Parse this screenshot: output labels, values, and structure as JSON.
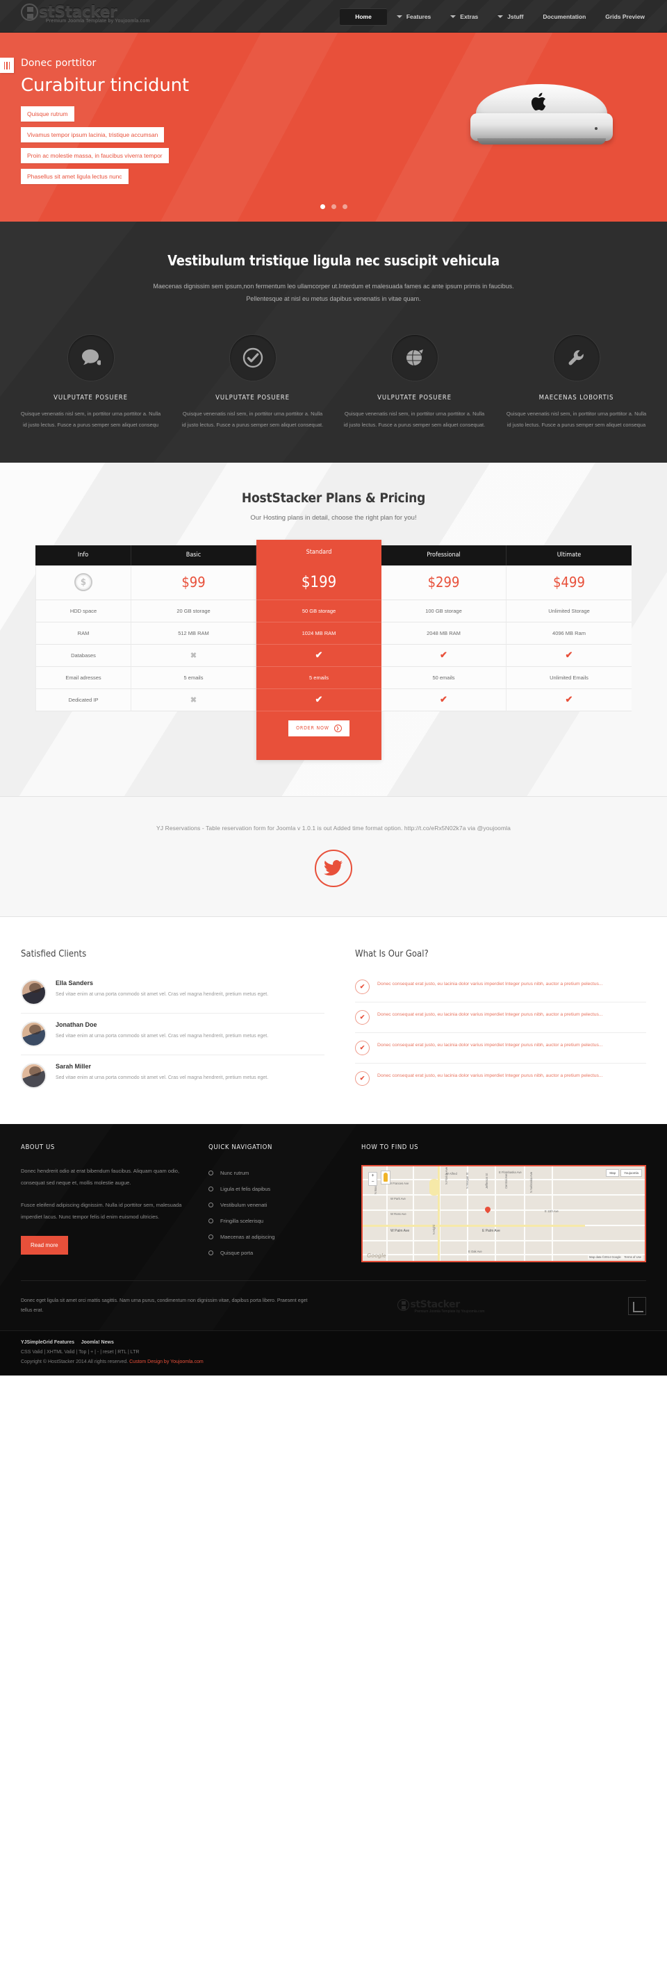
{
  "header": {
    "logo_text": "stStacker",
    "logo_tagline": "Premium Joomla Template by Youjoomla.com",
    "nav": [
      {
        "label": "Home",
        "active": true,
        "caret": false
      },
      {
        "label": "Features",
        "active": false,
        "caret": true
      },
      {
        "label": "Extras",
        "active": false,
        "caret": true
      },
      {
        "label": "Jstuff",
        "active": false,
        "caret": true
      },
      {
        "label": "Documentation",
        "active": false,
        "caret": false
      },
      {
        "label": "Grids Preview",
        "active": false,
        "caret": false
      }
    ]
  },
  "hero": {
    "kicker": "Donec porttitor",
    "title": "Curabitur tincidunt",
    "items": [
      "Quisque rutrum",
      "Vivamus tempor ipsum lacinia, tristique accumsan",
      "Proin ac molestie massa, in faucibus viverra tempor",
      "Phasellus sit amet ligula lectus nunc"
    ],
    "dots": [
      true,
      false,
      false
    ]
  },
  "features": {
    "title": "Vestibulum tristique ligula nec suscipit vehicula",
    "subtitle_line1": "Maecenas dignissim sem ipsum,non fermentum leo ullamcorper ut.Interdum et malesuada fames ac ante ipsum primis in faucibus.",
    "subtitle_line2": "Pellentesque at nisl eu metus dapibus venenatis in vitae quam.",
    "items": [
      {
        "icon": "speech-bubble-icon",
        "title": "VULPUTATE POSUERE",
        "text": "Quisque venenatis nisl sem, in porttitor urna porttitor a. Nulla id justo lectus. Fusce a purus semper sem aliquet consequ"
      },
      {
        "icon": "check-circle-icon",
        "title": "VULPUTATE POSUERE",
        "text": "Quisque venenatis nisl sem, in porttitor urna porttitor a. Nulla id justo lectus. Fusce a purus semper sem aliquet consequat."
      },
      {
        "icon": "globe-icon",
        "title": "VULPUTATE POSUERE",
        "text": "Quisque venenatis nisl sem, in porttitor urna porttitor a. Nulla id justo lectus. Fusce a purus semper sem aliquet consequat."
      },
      {
        "icon": "wrench-icon",
        "title": "MAECENAS LOBORTIS",
        "text": "Quisque venenatis nisl sem, in porttitor urna porttitor a. Nulla id justo lectus. Fusce a purus semper sem aliquet consequa"
      }
    ]
  },
  "pricing": {
    "title": "HostStacker Plans & Pricing",
    "subtitle": "Our Hosting plans in detail, choose the right plan for you!",
    "order_label": "ORDER NOW",
    "row_labels": [
      "HDD space",
      "RAM",
      "Databases",
      "Email adresses",
      "Dedicated IP"
    ],
    "info_header": "Info",
    "columns": [
      {
        "name": "Basic",
        "price": "$99",
        "highlight": false,
        "cells": [
          "20 GB storage",
          "512 MB RAM",
          "cross",
          "5 emails",
          "cross"
        ]
      },
      {
        "name": "Standard",
        "price": "$199",
        "highlight": true,
        "cells": [
          "50 GB storage",
          "1024 MB RAM",
          "tick",
          "5 emails",
          "tick"
        ]
      },
      {
        "name": "Professional",
        "price": "$299",
        "highlight": false,
        "cells": [
          "100 GB storage",
          "2048 MB RAM",
          "tick",
          "50 emails",
          "tick"
        ]
      },
      {
        "name": "Ultimate",
        "price": "$499",
        "highlight": false,
        "cells": [
          "Unlimited Storage",
          "4096 MB Ram",
          "tick",
          "Unlimited Emails",
          "tick"
        ]
      }
    ]
  },
  "twitter": {
    "tweet": "YJ Reservations - Table reservation form for Joomla v 1.0.1 is out Added time format option. http://t.co/eRx5N02k7a via @youjoomla",
    "icon": "twitter-bird-icon"
  },
  "clients": {
    "heading": "Satisfied Clients",
    "items": [
      {
        "name": "Ella Sanders",
        "text": "Sed vitae enim at urna porta commodo sit amet vel. Cras vel magna hendrerit, pretium metus eget."
      },
      {
        "name": "Jonathan Doe",
        "text": "Sed vitae enim at urna porta commodo sit amet vel. Cras vel magna hendrerit, pretium metus eget."
      },
      {
        "name": "Sarah Miller",
        "text": "Sed vitae enim at urna porta commodo sit amet vel. Cras vel magna hendrerit, pretium metus eget."
      }
    ]
  },
  "goals": {
    "heading": "What Is Our Goal?",
    "items": [
      "Donec consequat erat justo, eu lacinia dolor varius imperdiet Integer purus nibh, auctor a pretium pelectus...",
      "Donec consequat erat justo, eu lacinia dolor varius imperdiet Integer purus nibh, auctor a pretium pelectus...",
      "Donec consequat erat justo, eu lacinia dolor varius imperdiet Integer purus nibh, auctor a pretium pelectus...",
      "Donec consequat erat justo, eu lacinia dolor varius imperdiet Integer purus nibh, auctor a pretium pelectus..."
    ]
  },
  "footer": {
    "about": {
      "heading": "ABOUT US",
      "p1": "Donec hendrerit odio at erat bibendum faucibus. Aliquam quam odio, consequat sed neque et, mollis molestie augue.",
      "p2": "Fusce eleifend adipiscing dignissim. Nulla id porttitor sem, malesuada imperdiet lacus. Nunc tempor felis id enim euismod ultricies.",
      "button": "Read more"
    },
    "quicknav": {
      "heading": "QUICK NAVIGATION",
      "items": [
        "Nunc rutrum",
        "Ligula et felis dapibus",
        "Vestibulum venenati",
        "Fringilla scelerisqu",
        "Maecenas at adipiscing",
        "Quisque porta"
      ]
    },
    "map": {
      "heading": "HOW TO FIND US",
      "credit": "Map data ©2014 Google",
      "terms": "Terms of Use",
      "report": "Map",
      "place": "Youjoomla",
      "labels": [
        "W Alfred",
        "E Florebaska Ave",
        "W Frances Ave",
        "W Park Ave",
        "W Ross Ave",
        "W Palm Ave",
        "E Palm Ave",
        "E Oak Ave",
        "E 11th Ave",
        "N Florida Ave",
        "N Boulevard",
        "N Massachusetts Ave",
        "Nevada Ave",
        "N Morgan St",
        "Jefferson St",
        "Central Ave",
        "N Nebraska Ave",
        "N Highl",
        "S Ave"
      ],
      "watermark": "Google"
    },
    "bottom_text": "Donec eget ligula sit amet orci mattis sagittis. Nam urna purus, condimentum non dignissim vitae, dapibus porta libero. Praesent eget tellus erat.",
    "logo_text": "stStacker",
    "logo_tagline": "Premium Joomla Template by Youjoomla.com"
  },
  "copybar": {
    "links_plain": "YJSimpleGrid Features    Joomla! News",
    "link1": "YJSimpleGrid Features",
    "link2": "Joomla! News",
    "valid": "CSS Valid | XHTML Valid | Top | + | - | reset | RTL | LTR",
    "copyright": "Copyright © HostStacker 2014 All rights reserved.",
    "design_by": "Custom Design by Youjoomla.com"
  },
  "colors": {
    "accent": "#e8503a",
    "dark": "#2e2e2e",
    "header": "#2b2b2b",
    "footer": "#0d0d0d"
  }
}
